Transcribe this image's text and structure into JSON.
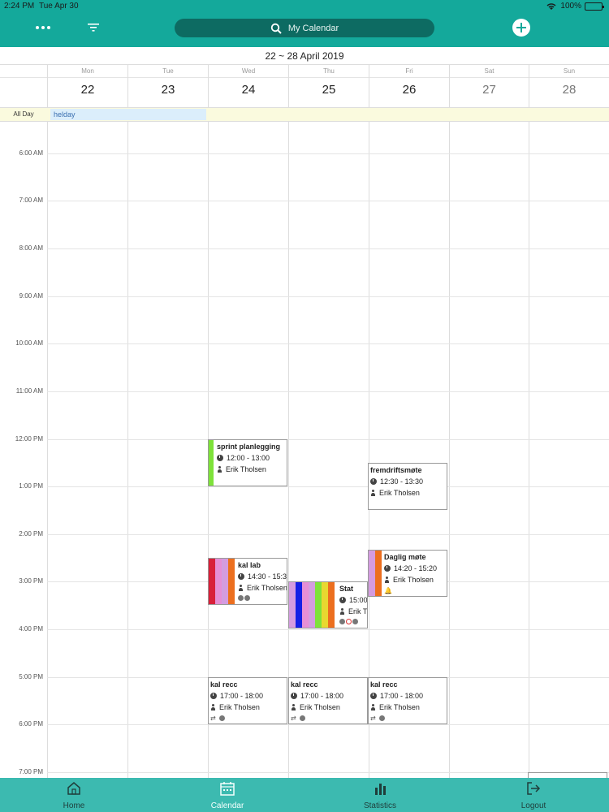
{
  "status": {
    "time": "2:24 PM",
    "date": "Tue Apr 30",
    "battery": "100%"
  },
  "header": {
    "search_placeholder": "My Calendar",
    "accent": "#14a99b"
  },
  "week": {
    "title": "22 ~ 28 April 2019",
    "days": [
      {
        "name": "Mon",
        "num": "22"
      },
      {
        "name": "Tue",
        "num": "23"
      },
      {
        "name": "Wed",
        "num": "24"
      },
      {
        "name": "Thu",
        "num": "25"
      },
      {
        "name": "Fri",
        "num": "26"
      },
      {
        "name": "Sat",
        "num": "27"
      },
      {
        "name": "Sun",
        "num": "28"
      }
    ]
  },
  "allday": {
    "label": "All Day",
    "event": "helday"
  },
  "times": [
    "6:00 AM",
    "7:00 AM",
    "8:00 AM",
    "9:00 AM",
    "10:00 AM",
    "11:00 AM",
    "12:00 PM",
    "1:00 PM",
    "2:00 PM",
    "3:00 PM",
    "4:00 PM",
    "5:00 PM",
    "6:00 PM",
    "7:00 PM"
  ],
  "events": [
    {
      "id": "sprint",
      "title": "sprint planlegging",
      "time": "12:00 - 13:00",
      "person": "Erik  Tholsen"
    },
    {
      "id": "fremdrift",
      "title": "fremdriftsmøte",
      "time": "12:30 - 13:30",
      "person": "Erik  Tholsen"
    },
    {
      "id": "kallab",
      "title": "kal lab",
      "time": "14:30 - 15:3",
      "person": "Erik  Tholsen"
    },
    {
      "id": "daglig",
      "title": "Daglig møte",
      "time": "14:20 - 15:20",
      "person": "Erik  Tholsen"
    },
    {
      "id": "stat",
      "title": "Stat",
      "time": "15:00",
      "person": "Erik  T"
    },
    {
      "id": "recc1",
      "title": "kal recc",
      "time": "17:00 - 18:00",
      "person": "Erik  Tholsen"
    },
    {
      "id": "recc2",
      "title": "kal recc",
      "time": "17:00 - 18:00",
      "person": "Erik  Tholsen"
    },
    {
      "id": "recc3",
      "title": "kal recc",
      "time": "17:00 - 18:00",
      "person": "Erik  Tholsen"
    }
  ],
  "tabs": [
    {
      "label": "Home"
    },
    {
      "label": "Calendar"
    },
    {
      "label": "Statistics"
    },
    {
      "label": "Logout"
    }
  ]
}
